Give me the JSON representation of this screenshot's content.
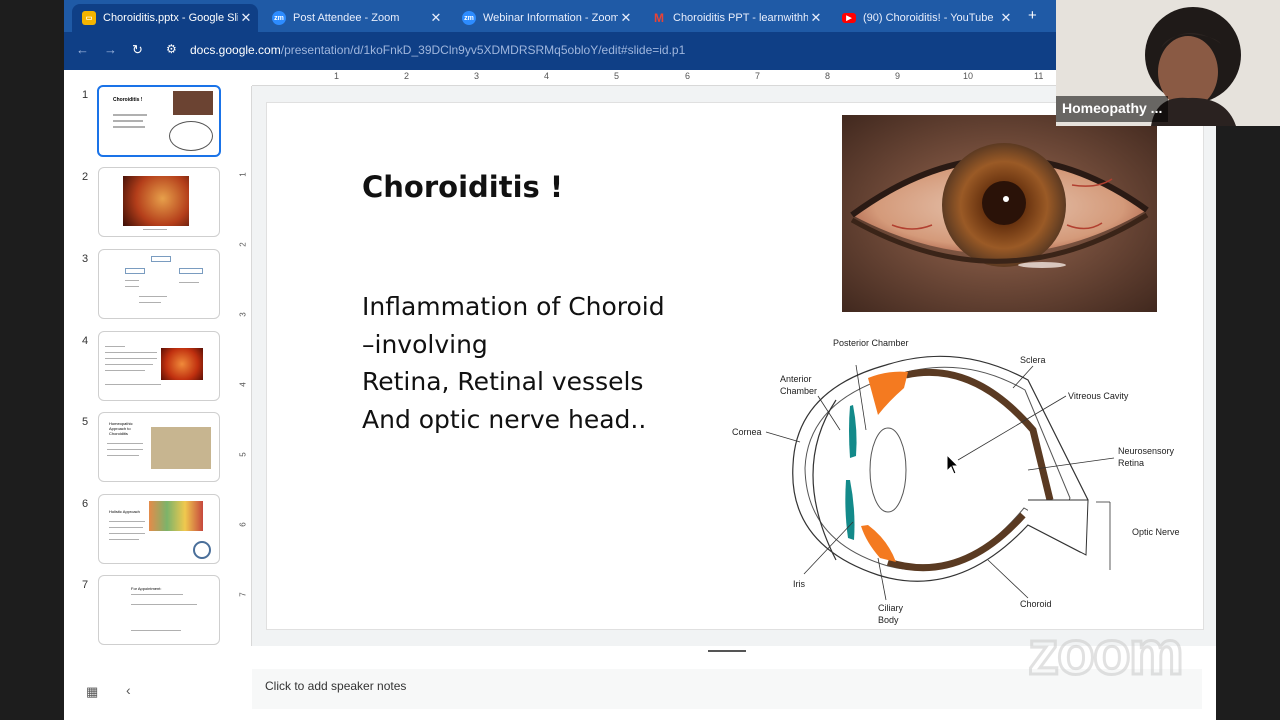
{
  "browser": {
    "tabs": [
      {
        "title": "Choroiditis.pptx - Google Slid",
        "icon": "google-slides-icon",
        "color": "#f4b400",
        "active": true
      },
      {
        "title": "Post Attendee - Zoom",
        "icon": "zoom-icon",
        "color": "#2d8cff",
        "active": false
      },
      {
        "title": "Webinar Information - Zoom",
        "icon": "zoom-icon",
        "color": "#2d8cff",
        "active": false
      },
      {
        "title": "Choroiditis PPT - learnwithhh",
        "icon": "gmail-icon",
        "color": "#ea4335",
        "active": false
      },
      {
        "title": "(90) Choroiditis! - YouTube",
        "icon": "youtube-icon",
        "color": "#ff0000",
        "active": false
      }
    ],
    "new_tab": "+",
    "close_glyph": "✕",
    "url_host": "docs.google.com",
    "url_path": "/presentation/d/1koFnkD_39DCln9yv5XDMDRSRMq5obloY/edit#slide=id.p1"
  },
  "ruler": {
    "h": [
      "1",
      "2",
      "3",
      "4",
      "5",
      "6",
      "7",
      "8",
      "9",
      "10",
      "11"
    ],
    "v": [
      "1",
      "2",
      "3",
      "4",
      "5",
      "6",
      "7"
    ]
  },
  "thumbnails": [
    {
      "num": "1",
      "title": "Choroiditis !"
    },
    {
      "num": "2"
    },
    {
      "num": "3"
    },
    {
      "num": "4"
    },
    {
      "num": "5",
      "title": "Homeopathic Approach to Choroiditis"
    },
    {
      "num": "6",
      "title": "Holistic Approach"
    },
    {
      "num": "7",
      "title": "For Appointment:"
    }
  ],
  "slide": {
    "title": "Choroiditis !",
    "body_lines": [
      "Inflammation of Choroid",
      "–involving",
      "Retina, Retinal vessels",
      "And optic nerve head.."
    ],
    "diagram_labels": {
      "posterior_chamber": "Posterior Chamber",
      "sclera": "Sclera",
      "anterior_chamber": "Anterior Chamber",
      "vitreous_cavity": "Vitreous Cavity",
      "cornea": "Cornea",
      "neurosensory_retina": "Neurosensory Retina",
      "optic_nerve": "Optic Nerve",
      "iris": "Iris",
      "ciliary_body": "Ciliary Body",
      "choroid": "Choroid"
    }
  },
  "notes": {
    "placeholder": "Click to add speaker notes"
  },
  "video": {
    "name": "Homeopathy ..."
  },
  "watermark": "zoom",
  "colors": {
    "accent": "#1a73e8",
    "choroid": "#5a3a22",
    "ciliary": "#f47a20",
    "iris": "#138a8a"
  }
}
